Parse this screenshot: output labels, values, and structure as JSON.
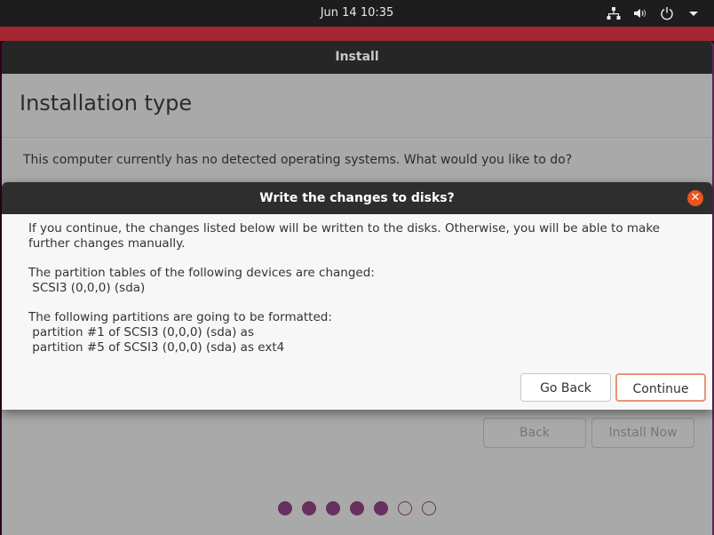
{
  "topbar": {
    "clock": "Jun 14  10:35",
    "tray_icons": [
      "network-icon",
      "volume-icon",
      "power-icon",
      "menu-arrow-icon"
    ]
  },
  "window": {
    "title": "Install",
    "page_title": "Installation type",
    "question": "This computer currently has no detected operating systems. What would you like to do?",
    "buttons": {
      "back": "Back",
      "install_now": "Install Now"
    },
    "progress": {
      "total_steps": 7,
      "completed_steps": 5
    }
  },
  "dialog": {
    "title": "Write the changes to disks?",
    "intro": "If you continue, the changes listed below will be written to the disks. Otherwise, you will be able to make further changes manually.",
    "tables_heading": "The partition tables of the following devices are changed:",
    "tables_devices": [
      " SCSI3 (0,0,0) (sda)"
    ],
    "format_heading": "The following partitions are going to be formatted:",
    "format_items": [
      " partition #1 of SCSI3 (0,0,0) (sda) as",
      " partition #5 of SCSI3 (0,0,0) (sda) as ext4"
    ],
    "buttons": {
      "go_back": "Go Back",
      "continue": "Continue"
    }
  },
  "colors": {
    "accent": "#e95420",
    "progress": "#67305e",
    "topbar": "#1d1d1d",
    "strip": "#a52731"
  }
}
